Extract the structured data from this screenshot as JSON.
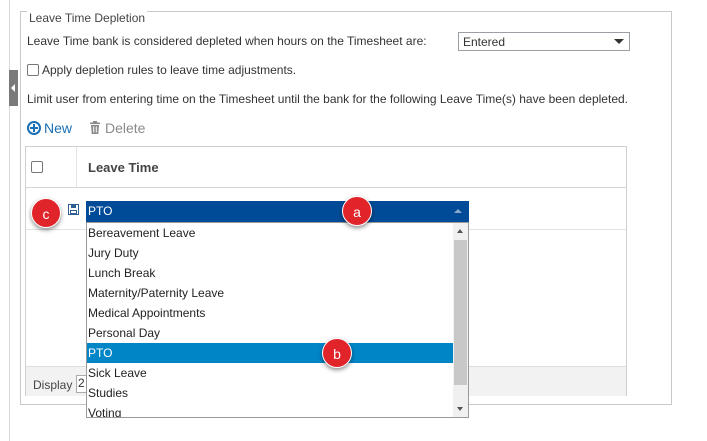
{
  "section": {
    "legend": "Leave Time Depletion",
    "depletion_label": "Leave Time bank is considered depleted when hours on the Timesheet are:",
    "depletion_value": "Entered",
    "apply_rules_label": "Apply depletion rules to leave time adjustments.",
    "limit_text": "Limit user from entering time on the Timesheet until the bank for the following Leave Time(s) have been depleted."
  },
  "toolbar": {
    "new_label": "New",
    "delete_label": "Delete"
  },
  "grid": {
    "column_header": "Leave Time",
    "editing_value": "PTO",
    "footer_label": "Display",
    "footer_value": "2"
  },
  "dropdown": {
    "options": [
      "Bereavement Leave",
      "Jury Duty",
      "Lunch Break",
      "Maternity/Paternity Leave",
      "Medical Appointments",
      "Personal Day",
      "PTO",
      "Sick Leave",
      "Studies",
      "Voting"
    ],
    "selected": "PTO"
  },
  "markers": {
    "a": "a",
    "b": "b",
    "c": "c"
  },
  "icons": {
    "new": "plus-circle-icon",
    "delete": "trash-icon",
    "save": "save-icon"
  },
  "colors": {
    "selected_row": "#0085c7",
    "combo": "#004b97",
    "marker": "#e0242a",
    "link": "#1a6fb5"
  }
}
